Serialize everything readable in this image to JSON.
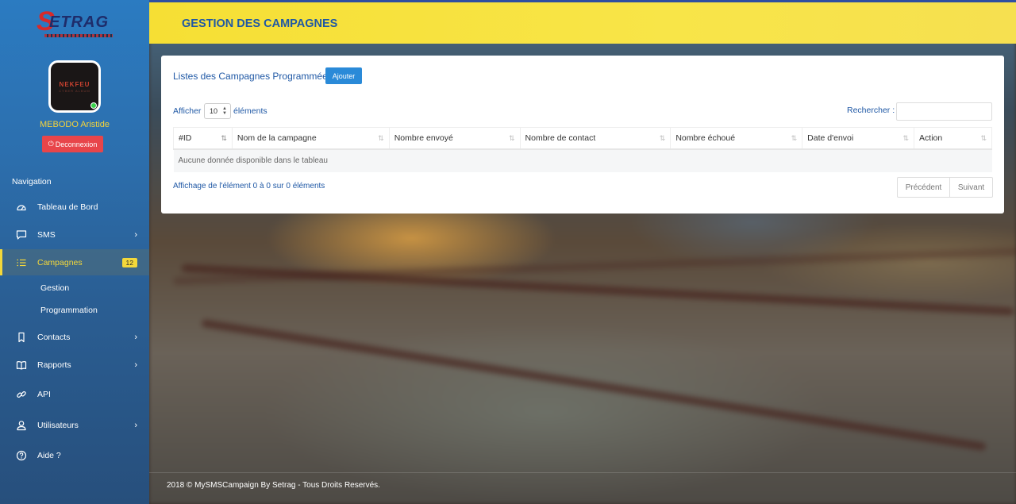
{
  "brand": {
    "logo_text": "ETRAG",
    "logo_initial": "S"
  },
  "user": {
    "name": "MEBODO Aristide",
    "avatar_text_1": "NEKFEU",
    "avatar_text_2": "CYBER ALBUM",
    "logout_label": "Deconnexion"
  },
  "sidebar": {
    "nav_title": "Navigation",
    "items": [
      {
        "label": "Tableau de Bord",
        "icon": "dashboard-icon"
      },
      {
        "label": "SMS",
        "icon": "message-icon"
      },
      {
        "label": "Campagnes",
        "icon": "list-icon",
        "badge": "12"
      },
      {
        "label": "Contacts",
        "icon": "bookmark-icon"
      },
      {
        "label": "Rapports",
        "icon": "book-icon"
      },
      {
        "label": "API",
        "icon": "link-icon"
      },
      {
        "label": "Utilisateurs",
        "icon": "user-icon"
      },
      {
        "label": "Aide ?",
        "icon": "help-icon"
      }
    ],
    "sub_items": [
      {
        "label": "Gestion"
      },
      {
        "label": "Programmation"
      }
    ]
  },
  "header": {
    "title": "GESTION DES CAMPAGNES"
  },
  "card": {
    "title": "Listes des Campagnes Programmées",
    "add_label": "Ajouter",
    "length_prefix": "Afficher",
    "length_value": "10",
    "length_suffix": "éléments",
    "search_label": "Rechercher :",
    "search_value": "",
    "columns": [
      "#ID",
      "Nom de la campagne",
      "Nombre envoyé",
      "Nombre de contact",
      "Nombre échoué",
      "Date d'envoi",
      "Action"
    ],
    "empty_text": "Aucune donnée disponible dans le tableau",
    "info_text": "Affichage de l'élément 0 à 0 sur 0 éléments",
    "prev_label": "Précédent",
    "next_label": "Suivant"
  },
  "footer": {
    "text": "2018 © MySMSCampaign By Setrag - Tous Droits Reservés."
  },
  "colors": {
    "accent_blue": "#1f58a5",
    "header_yellow": "#f6df34",
    "badge_yellow": "#f4d83a",
    "logout_red": "#e8454a",
    "button_blue": "#2a8ad8"
  }
}
